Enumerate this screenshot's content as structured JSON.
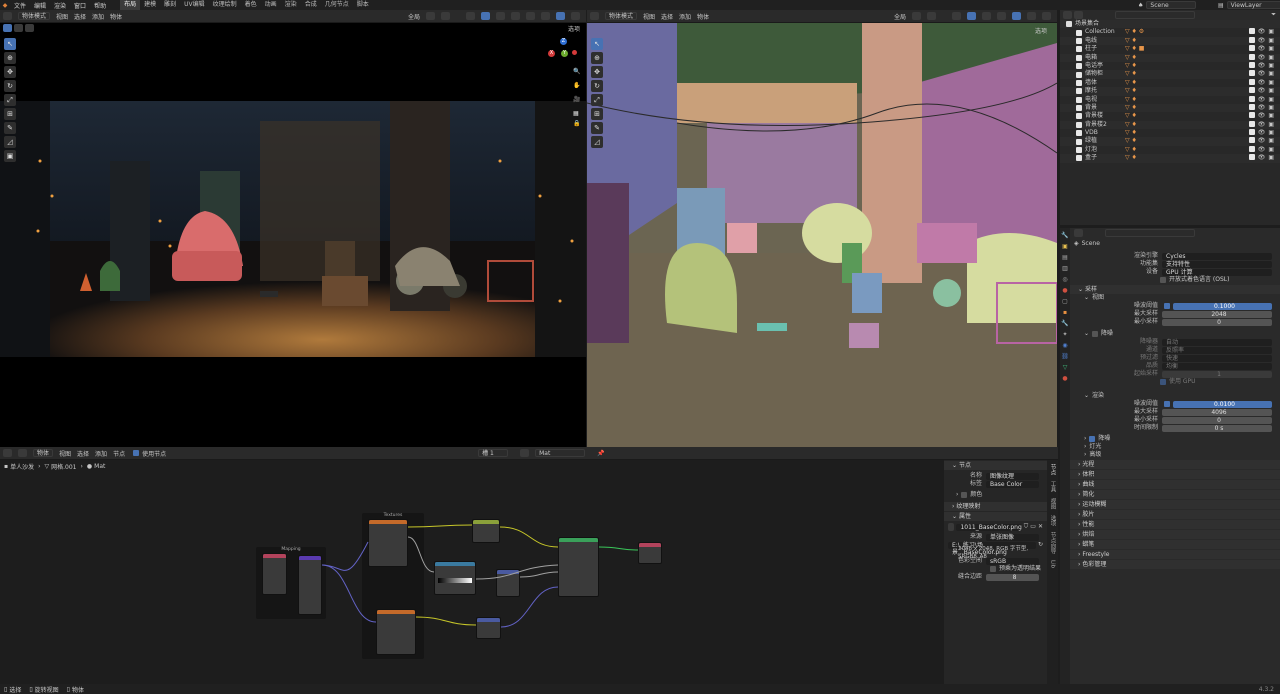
{
  "topbar": {
    "menus": [
      "文件",
      "编辑",
      "渲染",
      "窗口",
      "帮助"
    ],
    "workspaces": [
      "布局",
      "建模",
      "雕刻",
      "UV编辑",
      "纹理绘制",
      "着色",
      "动画",
      "渲染",
      "合成",
      "几何节点",
      "脚本"
    ],
    "active_workspace": "布局",
    "scene": "Scene",
    "viewlayer": "ViewLayer"
  },
  "viewport_left": {
    "mode": "物体模式",
    "menus": [
      "视图",
      "选择",
      "添加",
      "物体"
    ],
    "transform": "全局",
    "select_label": "选项"
  },
  "viewport_right": {
    "mode": "物体模式",
    "menus": [
      "视图",
      "选择",
      "添加",
      "物体"
    ],
    "transform": "全局",
    "select_label": "选项"
  },
  "gizmo": {
    "x": "X",
    "y": "Y",
    "z": "Z"
  },
  "outliner": {
    "search_placeholder": "",
    "root": "场景集合",
    "items": [
      {
        "name": "Collection",
        "icons": "▽ ♦ ⚙"
      },
      {
        "name": "电线",
        "icons": "▽ ♦"
      },
      {
        "name": "柱子",
        "icons": "▽ ♦ ■"
      },
      {
        "name": "电箱",
        "icons": "▽ ♦"
      },
      {
        "name": "电话亭",
        "icons": "▽ ♦"
      },
      {
        "name": "储物柜",
        "icons": "▽ ♦"
      },
      {
        "name": "墙体",
        "icons": "▽ ♦"
      },
      {
        "name": "摩托",
        "icons": "▽ ♦"
      },
      {
        "name": "电视",
        "icons": "▽ ♦"
      },
      {
        "name": "背景",
        "icons": "▽ ♦"
      },
      {
        "name": "背景楼",
        "icons": "▽ ♦"
      },
      {
        "name": "背景楼2",
        "icons": "▽ ♦"
      },
      {
        "name": "VDB",
        "icons": "▽ ♦"
      },
      {
        "name": "绿植",
        "icons": "▽ ♦"
      },
      {
        "name": "灯泡",
        "icons": "▽ ♦"
      },
      {
        "name": "盒子",
        "icons": "▽ ♦"
      }
    ]
  },
  "properties": {
    "scene_name": "Scene",
    "render_engine_label": "渲染引擎",
    "render_engine": "Cycles",
    "feature_set_label": "功能集",
    "feature_set": "支持特性",
    "device_label": "设备",
    "device": "GPU 计算",
    "osl_label": "开放式着色语言 (OSL)",
    "sampling": "采样",
    "viewport": "视图",
    "noise_threshold_label": "噪波阈值",
    "viewport_noise_threshold": "0.1000",
    "max_samples_label": "最大采样",
    "viewport_max_samples": "2048",
    "min_samples_label": "最小采样",
    "viewport_min_samples": "0",
    "denoise": "降噪",
    "denoiser_label": "降噪器",
    "denoiser": "自动",
    "pass_label": "通道",
    "pass": "反照率",
    "prefilter_label": "预过滤",
    "prefilter": "快速",
    "quality_label": "品质",
    "quality": "均衡",
    "start_sample_label": "起始采样",
    "start_sample": "1",
    "use_gpu": "使用 GPU",
    "render": "渲染",
    "render_noise_threshold": "0.0100",
    "render_max_samples": "4096",
    "render_min_samples": "0",
    "time_limit_label": "时间限制",
    "time_limit": "0 s",
    "render_denoise": "降噪",
    "lights": "灯光",
    "advanced": "高级",
    "sections": [
      "光程",
      "体积",
      "曲线",
      "简化",
      "运动模糊",
      "胶片",
      "性能",
      "烘焙",
      "蜡笔",
      "Freestyle",
      "色彩管理"
    ]
  },
  "node_editor": {
    "object_label": "物体",
    "menus": [
      "视图",
      "选择",
      "添加",
      "节点"
    ],
    "use_nodes": "使用节点",
    "slot": "槽 1",
    "material": "Mat",
    "breadcrumb": [
      "单人沙发",
      "网格.001",
      "Mat"
    ],
    "frames": [
      "Mapping",
      "Textures"
    ]
  },
  "node_panel": {
    "section_node": "节点",
    "name_label": "名称",
    "name_value": "图像纹理",
    "label_label": "标签",
    "label_value": "Base Color",
    "color_label": "颜色",
    "texture_mapping": "纹理映射",
    "properties": "属性",
    "image_name": "1011_BaseColor.png",
    "source_label": "来源",
    "source": "单张图像",
    "filepath": "E:\\_练习\\场景...BaseColor.png",
    "image_info": "2048 x 2048,  RGB 字节型, SRGB8_A8",
    "colorspace_label": "色彩空间",
    "colorspace": "sRGB",
    "alpha_premul": "预乘为透明结果",
    "start_frame_label": "缝合边距",
    "start_frame": "8",
    "tabs": [
      "节点",
      "工具",
      "视图",
      "选项",
      "节点向导",
      "Lib"
    ]
  },
  "statusbar": {
    "items": [
      "选择",
      "旋转视图",
      "物体"
    ],
    "version": "4.3.2"
  }
}
